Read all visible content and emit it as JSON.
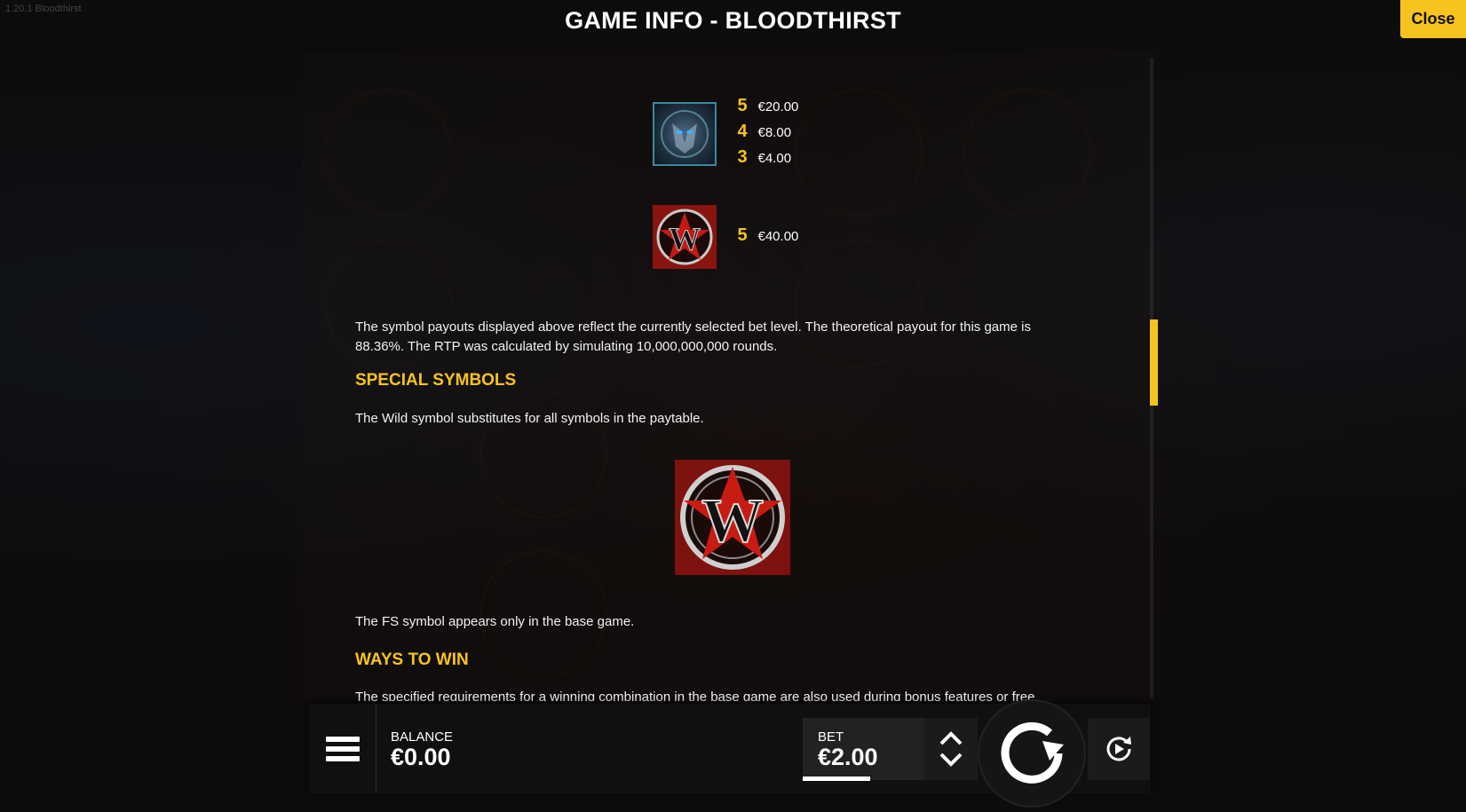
{
  "window": {
    "title": "GAME INFO - BLOODTHIRST",
    "close_label": "Close",
    "version": "1.20.1 Bloodthirst"
  },
  "paytable": [
    {
      "symbol": "vampire-symbol",
      "payouts": [
        {
          "count": "5",
          "amount": "€20.00"
        },
        {
          "count": "4",
          "amount": "€8.00"
        },
        {
          "count": "3",
          "amount": "€4.00"
        }
      ]
    },
    {
      "symbol": "wild-symbol",
      "payouts": [
        {
          "count": "5",
          "amount": "€40.00"
        }
      ]
    }
  ],
  "rtp_text": "The symbol payouts displayed above reflect the currently selected bet level. The theoretical payout for this game is 88.36%. The RTP was calculated by simulating 10,000,000,000 rounds.",
  "special_symbols": {
    "heading": "SPECIAL SYMBOLS",
    "wild_text": "The Wild symbol substitutes for all symbols in the paytable.",
    "fs_text": "The FS symbol appears only in the base game."
  },
  "ways_to_win": {
    "heading": "WAYS TO WIN",
    "text": "The specified requirements for a winning combination in the base game are also used during bonus features or free"
  },
  "bottom_bar": {
    "balance_label": "BALANCE",
    "balance_value": "€0.00",
    "bet_label": "BET",
    "bet_value": "€2.00"
  },
  "colors": {
    "accent": "#f7c31e",
    "background": "#141210",
    "bar": "#101010"
  }
}
